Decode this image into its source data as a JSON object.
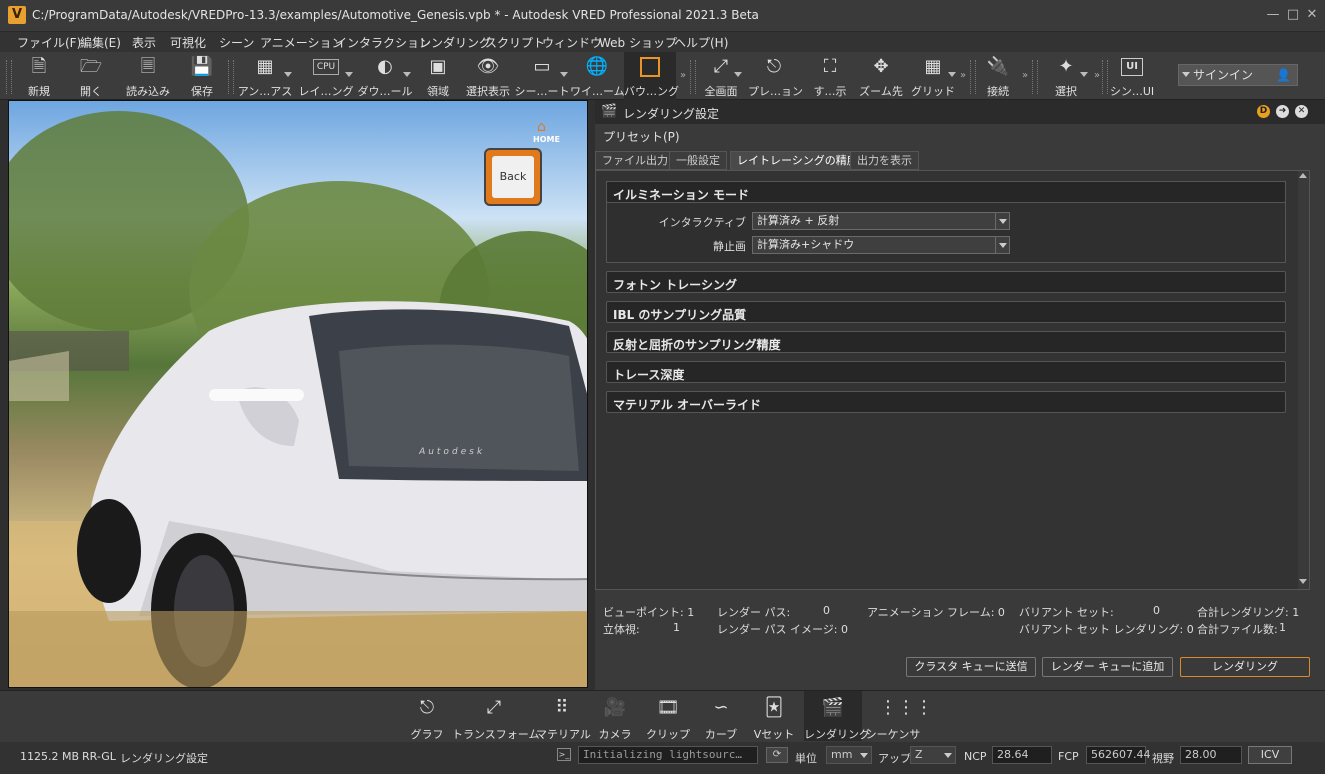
{
  "window": {
    "title": "C:/ProgramData/Autodesk/VREDPro-13.3/examples/Automotive_Genesis.vpb * - Autodesk VRED Professional 2021.3 Beta",
    "logo": "V"
  },
  "menu": [
    "ファイル(F)",
    "編集(E)",
    "表示",
    "可視化",
    "シーン",
    "アニメーション",
    "インタラクション",
    "レンダリング",
    "スクリプト",
    "ウィンドウ",
    "Web ショップ",
    "ヘルプ(H)"
  ],
  "toolbar": [
    {
      "label": "新規",
      "icon": "new-file-icon"
    },
    {
      "label": "開く",
      "icon": "open-folder-icon"
    },
    {
      "label": "読み込み",
      "icon": "import-icon"
    },
    {
      "label": "保存",
      "icon": "save-icon"
    },
    {
      "label": "アン…アス",
      "icon": "antialiasing-icon"
    },
    {
      "label": "レイ…ング",
      "icon": "raytracing-cpu-icon",
      "badge": "CPU"
    },
    {
      "label": "ダウ…ール",
      "icon": "downscale-icon"
    },
    {
      "label": "領域",
      "icon": "region-icon"
    },
    {
      "label": "選択表示",
      "icon": "eye-icon"
    },
    {
      "label": "シー…ート",
      "icon": "scene-plate-icon"
    },
    {
      "label": "ワイ…ーム",
      "icon": "wireframe-icon"
    },
    {
      "label": "バウ…ング",
      "icon": "bounding-box-icon"
    },
    {
      "label": "全画面",
      "icon": "fullscreen-icon"
    },
    {
      "label": "プレ…ョン",
      "icon": "presentation-icon"
    },
    {
      "label": "す…示",
      "icon": "show-all-icon"
    },
    {
      "label": "ズーム先",
      "icon": "zoom-to-icon"
    },
    {
      "label": "グリッド",
      "icon": "grid-icon"
    },
    {
      "label": "接続",
      "icon": "connect-icon"
    },
    {
      "label": "選択",
      "icon": "select-icon"
    },
    {
      "label": "シン…UI",
      "icon": "simple-ui-icon",
      "badge": "UI"
    }
  ],
  "signin": "サインイン",
  "viewport": {
    "back_label": "Back",
    "home_label": "HOME",
    "car_badge": "Autodesk"
  },
  "panel": {
    "title": "レンダリング設定",
    "preset_menu": "プリセット(P)",
    "tabs": [
      "ファイル出力",
      "一般設定",
      "レイトレーシングの精度",
      "出力を表示"
    ],
    "active_tab": 2,
    "illumination": {
      "title": "イルミネーション モード",
      "interactive_label": "インタラクティブ",
      "interactive_value": "計算済み + 反射",
      "still_label": "静止画",
      "still_value": "計算済み+シャドウ"
    },
    "sections": [
      "フォトン トレーシング",
      "IBL のサンプリング品質",
      "反射と屈折のサンプリング精度",
      "トレース深度",
      "マテリアル オーバーライド"
    ],
    "stats": {
      "viewpoint": "ビューポイント: 1",
      "stereo": "立体視:",
      "stereo_val": "1",
      "render_pass": "レンダー パス:",
      "render_pass_val": "0",
      "render_pass_image": "レンダー パス イメージ: 0",
      "animation_frames": "アニメーション フレーム: 0",
      "variant_sets": "バリアント セット:",
      "variant_sets_val": "0",
      "variant_set_rendering": "バリアント セット レンダリング: 0",
      "total_rendering": "合計レンダリング: 1",
      "total_files": "合計ファイル数:",
      "total_files_val": "1"
    },
    "buttons": {
      "cluster": "クラスタ キューに送信",
      "queue": "レンダー キューに追加",
      "render": "レンダリング"
    }
  },
  "dock": [
    {
      "label": "グラフ",
      "icon": "graph-icon"
    },
    {
      "label": "トランスフォーム",
      "icon": "transform-icon"
    },
    {
      "label": "マテリアル",
      "icon": "material-icon"
    },
    {
      "label": "カメラ",
      "icon": "camera-icon"
    },
    {
      "label": "クリップ",
      "icon": "clip-icon"
    },
    {
      "label": "カーブ",
      "icon": "curve-icon"
    },
    {
      "label": "Vセット",
      "icon": "vset-icon"
    },
    {
      "label": "レンダリング",
      "icon": "clapper-icon"
    },
    {
      "label": "シーケンサ",
      "icon": "sequencer-icon"
    }
  ],
  "status": {
    "memory": "1125.2 MB",
    "renderer": "RR-GL",
    "module": "レンダリング設定",
    "console": "Initializing lightsourc…",
    "unit_label": "単位",
    "unit_value": "mm",
    "up_label": "アップ",
    "up_value": "Z",
    "ncp_label": "NCP",
    "ncp_value": "28.64",
    "fcp_label": "FCP",
    "fcp_value": "562607.44",
    "fov_label": "視野",
    "fov_value": "28.00",
    "icv": "ICV"
  },
  "colors": {
    "accent": "#d98a2b",
    "logo": "#e8a030",
    "panel_bg": "#3a3a3a"
  }
}
